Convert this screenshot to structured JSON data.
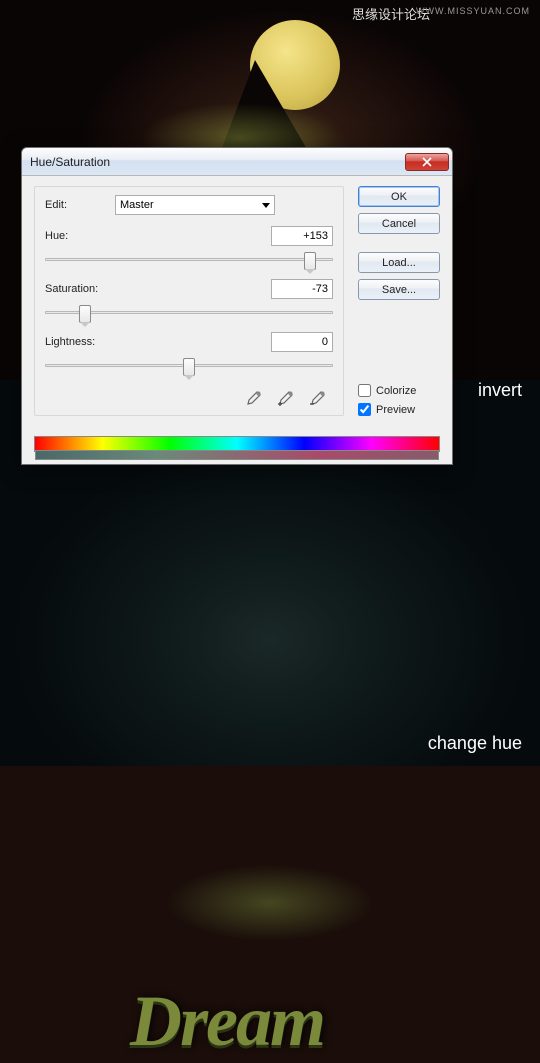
{
  "watermark": {
    "text": "思缘设计论坛",
    "url": "WWW.MISSYUAN.COM"
  },
  "bg_labels": {
    "invert": "invert",
    "change_hue": "change hue",
    "dream": "Dream"
  },
  "dialog": {
    "title": "Hue/Saturation",
    "close_icon": "close",
    "edit_label": "Edit:",
    "edit_value": "Master",
    "sliders": {
      "hue": {
        "label": "Hue:",
        "value": "+153",
        "pos": 92
      },
      "saturation": {
        "label": "Saturation:",
        "value": "-73",
        "pos": 14
      },
      "lightness": {
        "label": "Lightness:",
        "value": "0",
        "pos": 50
      }
    },
    "buttons": {
      "ok": "OK",
      "cancel": "Cancel",
      "load": "Load...",
      "save": "Save..."
    },
    "checkboxes": {
      "colorize": {
        "label": "Colorize",
        "checked": false
      },
      "preview": {
        "label": "Preview",
        "checked": true
      }
    }
  }
}
